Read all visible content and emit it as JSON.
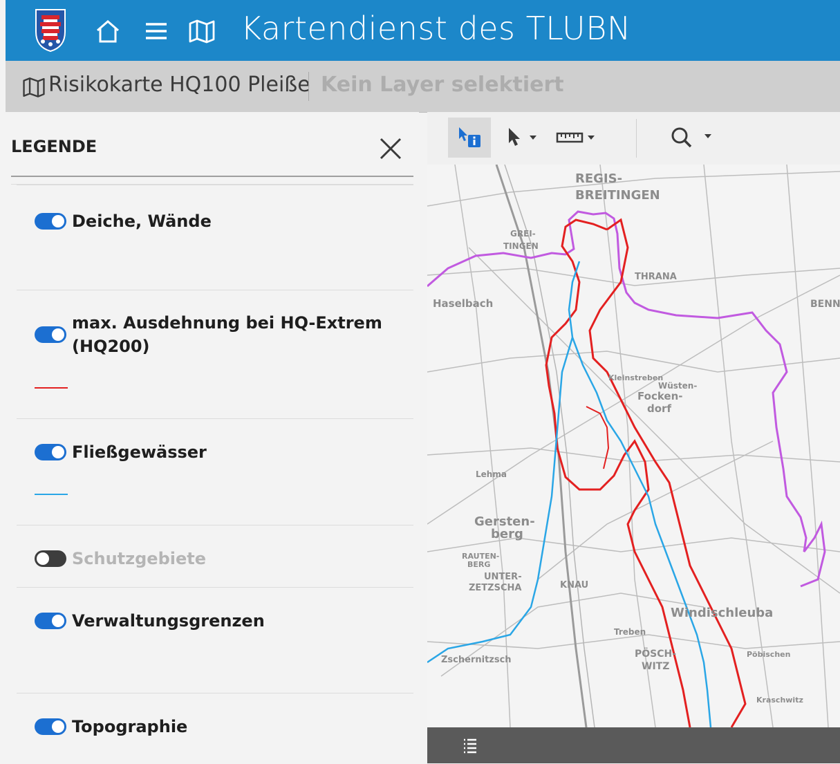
{
  "app": {
    "title": "Kartendienst des TLUBN",
    "icons": [
      "crest-icon",
      "home-icon",
      "menu-icon",
      "map-icon"
    ]
  },
  "breadcrumb": {
    "map_name": "Risikokarte HQ100 Pleiße",
    "layer_status": "Kein Layer selektiert"
  },
  "legend": {
    "header": "LEGENDE",
    "items": [
      {
        "label": "Deiche, Wände",
        "enabled": true,
        "swatch_color": null
      },
      {
        "label": "max. Ausdehnung bei HQ-Extrem (HQ200)",
        "enabled": true,
        "swatch_color": "#e32020"
      },
      {
        "label": "Fließgewässer",
        "enabled": true,
        "swatch_color": "#2aa6e6"
      },
      {
        "label": "Schutzgebiete",
        "enabled": false,
        "swatch_color": null
      },
      {
        "label": "Verwaltungsgrenzen",
        "enabled": true,
        "swatch_color": null
      },
      {
        "label": "Topographie",
        "enabled": true,
        "swatch_color": null
      }
    ]
  },
  "map": {
    "labels": [
      "REGIS-",
      "BREITINGEN",
      "GREI-",
      "TINGEN",
      "THRANA",
      "Haselbach",
      "BENN",
      "Kleinstreben",
      "Wüsten-",
      "Focken-",
      "dorf",
      "Lehma",
      "Gersten-",
      "berg",
      "RAUTEN-",
      "BERG",
      "UNTER-",
      "ZETZSCHA",
      "KNAU",
      "PÖSCH-",
      "WITZ",
      "Windischleuba",
      "Pöbischen",
      "Zschernitzsch",
      "Treben",
      "Kraschwitz"
    ],
    "colors": {
      "flood_extent": "#e32020",
      "river": "#2aa6e6",
      "admin_boundary": "#c15ae0"
    }
  }
}
